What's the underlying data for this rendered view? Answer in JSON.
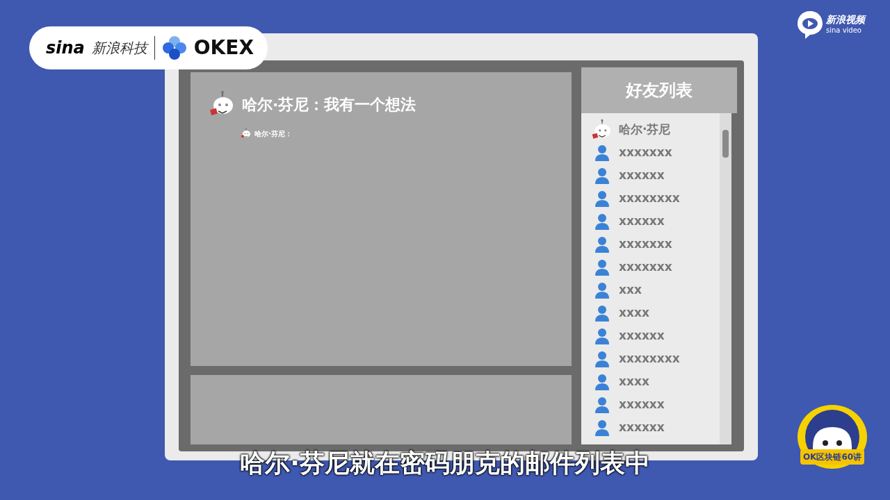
{
  "brand": {
    "sina": "sina",
    "sina_name": "新浪科技",
    "partner": "OKEX"
  },
  "video_brand": {
    "name": "新浪视频",
    "sub": "sina video"
  },
  "chat": {
    "title": "哈尔·芬尼：我有一个想法",
    "message_sender": "哈尔·芬尼："
  },
  "friends": {
    "title": "好友列表",
    "items": [
      {
        "kind": "robot",
        "name": "哈尔·芬尼"
      },
      {
        "kind": "user",
        "name": "xxxxxxx"
      },
      {
        "kind": "user",
        "name": "xxxxxx"
      },
      {
        "kind": "user",
        "name": "xxxxxxxx"
      },
      {
        "kind": "user",
        "name": "xxxxxx"
      },
      {
        "kind": "user",
        "name": "xxxxxxx"
      },
      {
        "kind": "user",
        "name": "xxxxxxx"
      },
      {
        "kind": "user",
        "name": "xxx"
      },
      {
        "kind": "user",
        "name": "xxxx"
      },
      {
        "kind": "user",
        "name": "xxxxxx"
      },
      {
        "kind": "user",
        "name": "xxxxxxxx"
      },
      {
        "kind": "user",
        "name": "xxxx"
      },
      {
        "kind": "user",
        "name": "xxxxxx"
      },
      {
        "kind": "user",
        "name": "xxxxxx"
      }
    ]
  },
  "subtitle": "哈尔·芬尼就在密码朋克的邮件列表中",
  "badge": "OK区块链60讲"
}
